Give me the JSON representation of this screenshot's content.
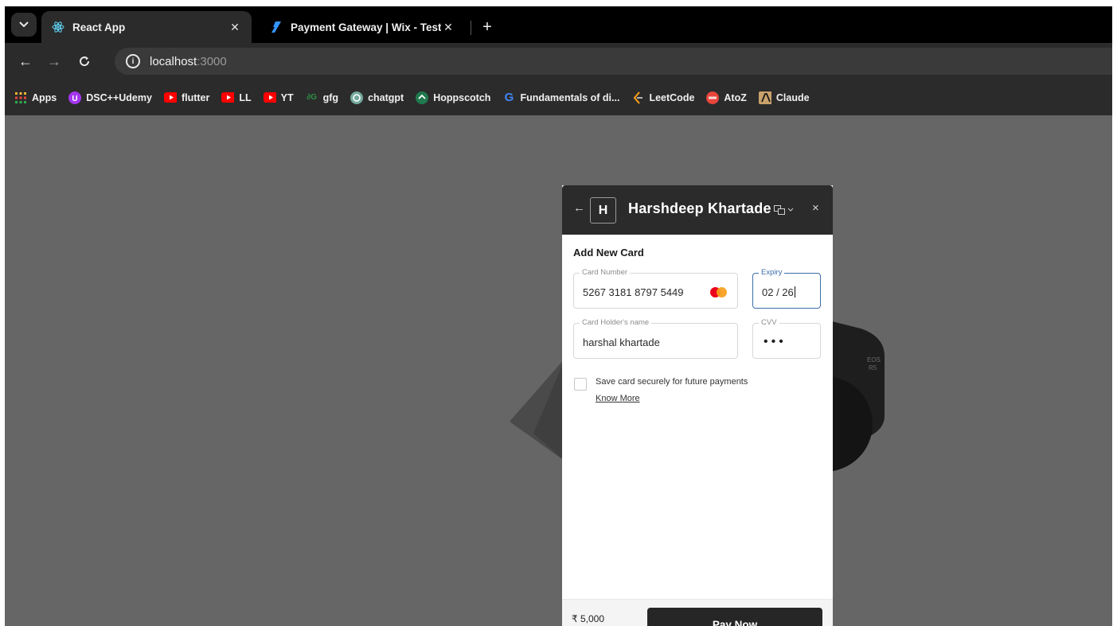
{
  "browser": {
    "tabs": [
      {
        "title": "React App",
        "active": true
      },
      {
        "title": "Payment Gateway | Wix - Test",
        "active": false
      }
    ],
    "address": {
      "host": "localhost",
      "port": ":3000"
    },
    "bookmarks": [
      {
        "label": "Apps",
        "icon": "apps-grid-icon",
        "color": "#f2b233"
      },
      {
        "label": "DSC++Udemy",
        "icon": "udemy-icon",
        "color": "#a435f0"
      },
      {
        "label": "flutter",
        "icon": "youtube-icon",
        "color": "#ff0000"
      },
      {
        "label": "LL",
        "icon": "youtube-icon",
        "color": "#ff0000"
      },
      {
        "label": "YT",
        "icon": "youtube-icon",
        "color": "#ff0000"
      },
      {
        "label": "gfg",
        "icon": "gfg-icon",
        "color": "#2f8d46"
      },
      {
        "label": "chatgpt",
        "icon": "chatgpt-icon",
        "color": "#74aa9c"
      },
      {
        "label": "Hoppscotch",
        "icon": "hoppscotch-icon",
        "color": "#1f7a4d"
      },
      {
        "label": "Fundamentals of di...",
        "icon": "google-icon",
        "color": "#4285f4"
      },
      {
        "label": "LeetCode",
        "icon": "leetcode-icon",
        "color": "#ffa116"
      },
      {
        "label": "AtoZ",
        "icon": "atoz-icon",
        "color": "#e8453c"
      },
      {
        "label": "Claude",
        "icon": "claude-icon",
        "color": "#c9a26b"
      }
    ]
  },
  "payment": {
    "back": "←",
    "merchant_initial": "H",
    "merchant_name": "Harshdeep Khartade",
    "close": "×",
    "section_title": "Add New Card",
    "card_number": {
      "label": "Card Number",
      "value": "5267 3181 8797 5449"
    },
    "expiry": {
      "label": "Expiry",
      "value": "02 / 26"
    },
    "holder": {
      "label": "Card Holder's name",
      "value": "harshal khartade"
    },
    "cvv": {
      "label": "CVV",
      "value": "•••"
    },
    "save_card": {
      "label": "Save card securely for future payments",
      "checked": false
    },
    "know_more": "Know More",
    "amount": "₹ 5,000",
    "pay_button": "Pay Now"
  }
}
